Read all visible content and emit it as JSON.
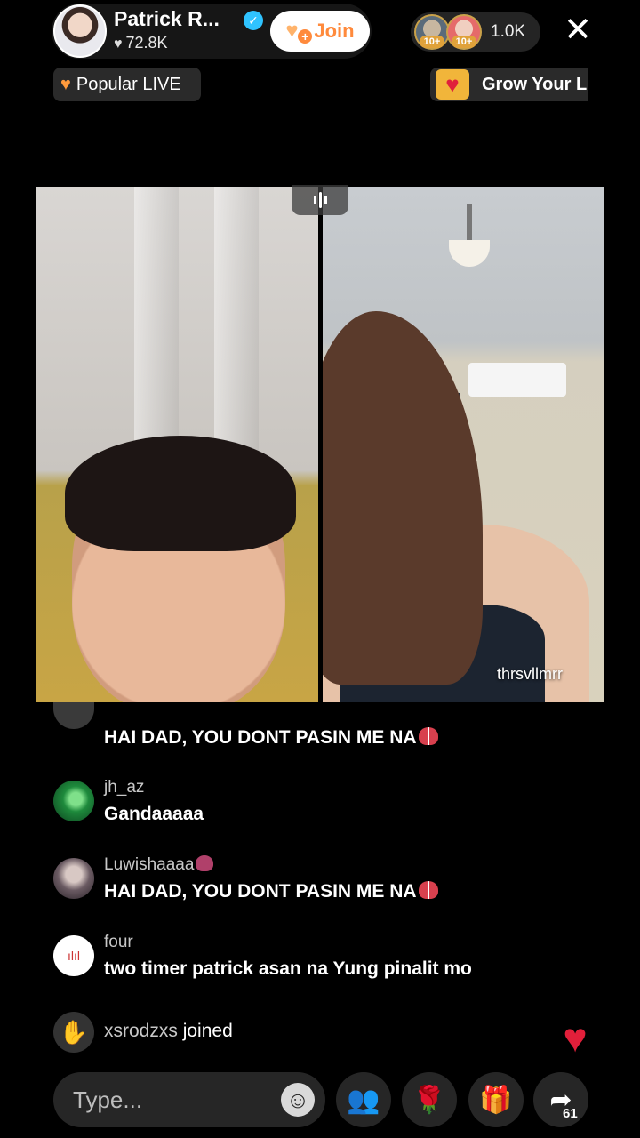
{
  "header": {
    "host_name": "Patrick R...",
    "likes": "72.8K",
    "join_label": "Join",
    "viewer_count": "1.0K",
    "viewer_badges": [
      "10+",
      "10+"
    ],
    "close_symbol": "✕"
  },
  "tags": {
    "popular_label": "Popular LIVE",
    "grow_label": "Grow Your LIVE"
  },
  "video": {
    "guest_name": "thrsvllmrr"
  },
  "chat": [
    {
      "user": "",
      "message": "HAI DAD, YOU DONT PASIN ME NA",
      "emoji": "heart"
    },
    {
      "user": "jh_az",
      "message": "Gandaaaaa"
    },
    {
      "user": "Luwishaaaa",
      "message": "HAI DAD, YOU DONT PASIN ME NA",
      "emoji": "heart"
    },
    {
      "user": "four",
      "message": "two timer patrick asan na Yung pinalit mo"
    }
  ],
  "join_notice": {
    "user": "xsrodzxs",
    "text": "joined"
  },
  "bottom_bar": {
    "type_placeholder": "Type...",
    "share_count": "61"
  },
  "colors": {
    "join_text": "#ff8a3c",
    "verified": "#2fc3ff",
    "heart_red": "#e21f3a",
    "multi_guest": "#27d9e6"
  }
}
